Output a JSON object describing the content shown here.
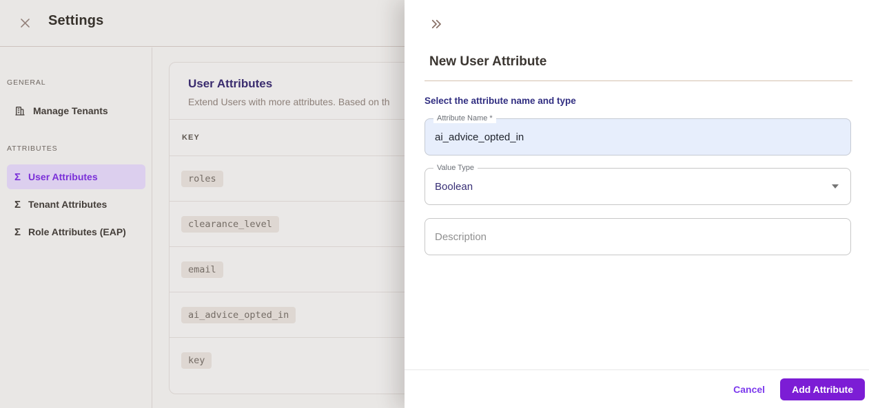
{
  "header": {
    "title": "Settings"
  },
  "sidebar": {
    "sections": [
      {
        "label": "GENERAL",
        "items": [
          {
            "label": "Manage Tenants",
            "icon": "building-icon",
            "selected": false
          }
        ]
      },
      {
        "label": "ATTRIBUTES",
        "items": [
          {
            "label": "User Attributes",
            "icon": "sigma-icon",
            "selected": true
          },
          {
            "label": "Tenant Attributes",
            "icon": "sigma-icon",
            "selected": false
          },
          {
            "label": "Role Attributes (EAP)",
            "icon": "sigma-icon",
            "selected": false
          }
        ]
      }
    ],
    "sigma_glyph": "Σ"
  },
  "main": {
    "card": {
      "title": "User Attributes",
      "subtitle": "Extend Users with more attributes. Based on th",
      "table": {
        "columns": [
          "KEY"
        ],
        "rows": [
          "roles",
          "clearance_level",
          "email",
          "ai_advice_opted_in",
          "key"
        ]
      }
    }
  },
  "drawer": {
    "collapse_icon": "chevrons-right-icon",
    "title": "New User Attribute",
    "section_heading": "Select the attribute name and type",
    "fields": {
      "attribute_name": {
        "label": "Attribute Name *",
        "value": "ai_advice_opted_in"
      },
      "value_type": {
        "label": "Value Type",
        "value": "Boolean"
      },
      "description": {
        "placeholder": "Description",
        "value": ""
      }
    },
    "footer": {
      "cancel_label": "Cancel",
      "submit_label": "Add Attribute"
    }
  },
  "colors": {
    "accent_purple": "#7c3aed",
    "submit_button_bg": "#7c1dd5",
    "selected_item_bg": "#dccfee",
    "selected_item_text": "#7a2fd8",
    "heading_indigo": "#312e81",
    "card_title_indigo": "#3a2c6e",
    "autofill_field_bg": "#e7eefc",
    "drawer_bg": "#ffffff",
    "dimmed_page_bg": "#e9e7e5",
    "tan_divider": "#d3c0ae"
  }
}
